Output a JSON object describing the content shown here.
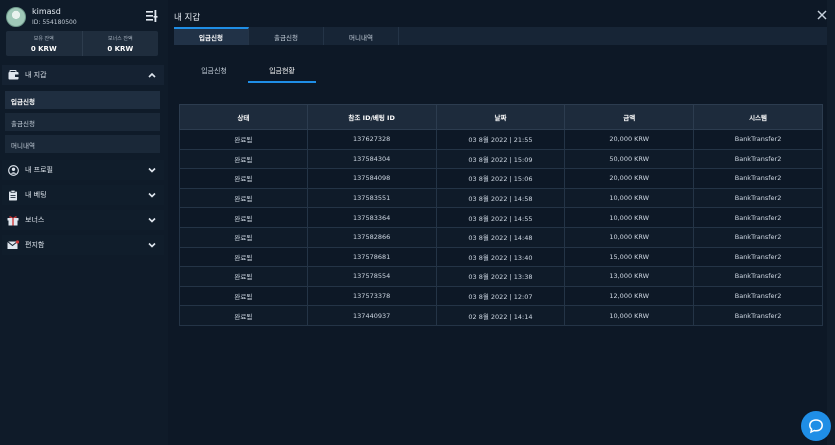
{
  "user": {
    "name": "kimasd",
    "id": "ID: 554180500"
  },
  "balances": [
    {
      "label": "보유 잔액",
      "value": "0 KRW"
    },
    {
      "label": "보너스 잔액",
      "value": "0 KRW"
    }
  ],
  "sidebar": {
    "wallet": {
      "label": "내 지갑",
      "items": [
        "입금신청",
        "출금신청",
        "머니내역"
      ]
    },
    "profile": {
      "label": "내 프로필"
    },
    "bets": {
      "label": "내 베팅"
    },
    "bonus": {
      "label": "보너스"
    },
    "mail": {
      "label": "편지함"
    }
  },
  "main": {
    "title": "내 지갑",
    "tabs": [
      "입금신청",
      "출금신청",
      "머니내역"
    ],
    "subtabs": [
      "입금신청",
      "입금현황"
    ]
  },
  "table": {
    "headers": [
      "상태",
      "참조 ID/베팅 ID",
      "날짜",
      "금액",
      "시스템"
    ],
    "rows": [
      [
        "완료됨",
        "137627328",
        "03 8월 2022 | 21:55",
        "20,000 KRW",
        "BankTransfer2"
      ],
      [
        "완료됨",
        "137584304",
        "03 8월 2022 | 15:09",
        "50,000 KRW",
        "BankTransfer2"
      ],
      [
        "완료됨",
        "137584098",
        "03 8월 2022 | 15:06",
        "20,000 KRW",
        "BankTransfer2"
      ],
      [
        "완료됨",
        "137583551",
        "03 8월 2022 | 14:58",
        "10,000 KRW",
        "BankTransfer2"
      ],
      [
        "완료됨",
        "137583364",
        "03 8월 2022 | 14:55",
        "10,000 KRW",
        "BankTransfer2"
      ],
      [
        "완료됨",
        "137582866",
        "03 8월 2022 | 14:48",
        "10,000 KRW",
        "BankTransfer2"
      ],
      [
        "완료됨",
        "137578681",
        "03 8월 2022 | 13:40",
        "15,000 KRW",
        "BankTransfer2"
      ],
      [
        "완료됨",
        "137578554",
        "03 8월 2022 | 13:38",
        "13,000 KRW",
        "BankTransfer2"
      ],
      [
        "완료됨",
        "137573378",
        "03 8월 2022 | 12:07",
        "12,000 KRW",
        "BankTransfer2"
      ],
      [
        "완료됨",
        "137440937",
        "02 8월 2022 | 14:14",
        "10,000 KRW",
        "BankTransfer2"
      ]
    ]
  },
  "colors": {
    "accent": "#1f8ee6",
    "background": "#0d1826",
    "sidebar": "#0f1b29"
  }
}
